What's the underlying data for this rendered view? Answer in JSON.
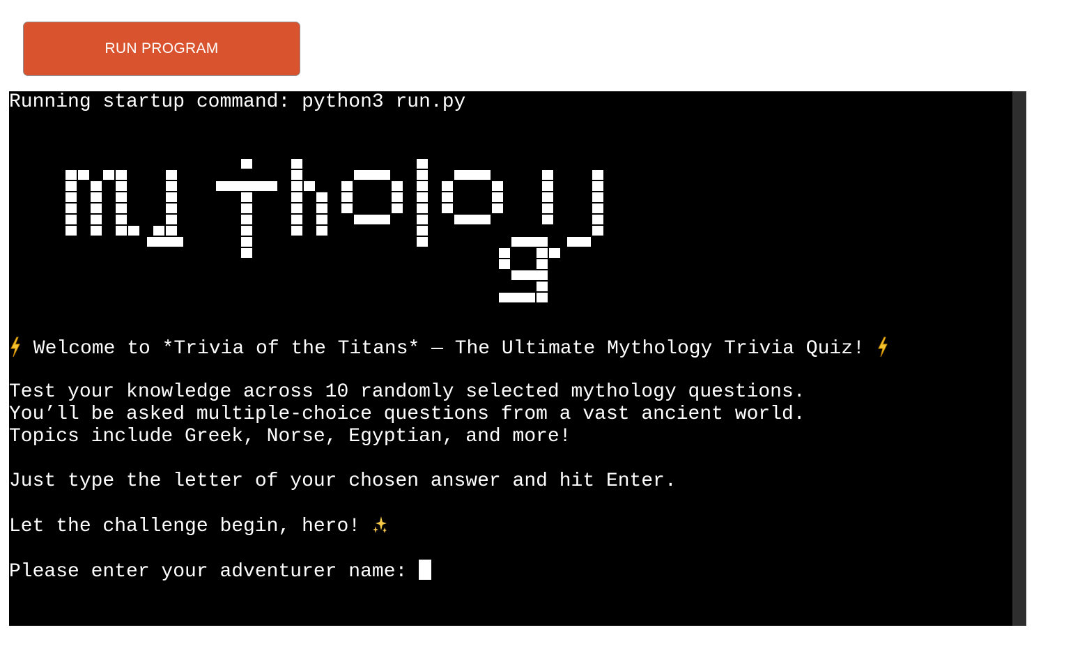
{
  "toolbar": {
    "run_label": "RUN PROGRAM",
    "run_color": "#d9542e"
  },
  "terminal": {
    "startup_line": "Running startup command: python3 run.py",
    "banner_text": "mythology",
    "welcome_text": " Welcome to *Trivia of the Titans* — The Ultimate Mythology Trivia Quiz! ",
    "welcome_icon": "lightning-bolt-icon",
    "intro_line_1": "Test your knowledge across 10 randomly selected mythology questions.",
    "intro_line_2": "You’ll be asked multiple-choice questions from a vast ancient world.",
    "intro_line_3": "Topics include Greek, Norse, Egyptian, and more!",
    "instructions": "Just type the letter of your chosen answer and hit Enter.",
    "challenge_text": "Let the challenge begin, hero! ",
    "challenge_icon": "sparkles-icon",
    "name_prompt": "Please enter your adventurer name:",
    "background": "#000000",
    "foreground": "#ffffff"
  }
}
